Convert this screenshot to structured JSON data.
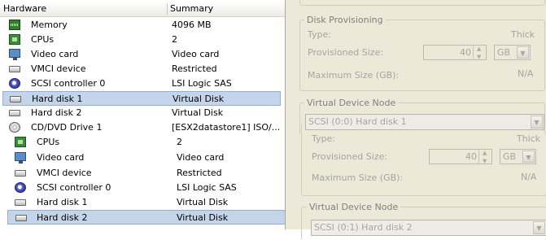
{
  "list_header": {
    "col_hardware": "Hardware",
    "col_summary": "Summary"
  },
  "top_list": [
    {
      "icon": "memory-icon",
      "name": "Memory",
      "summary": "4096 MB"
    },
    {
      "icon": "cpu-icon",
      "name": "CPUs",
      "summary": "2"
    },
    {
      "icon": "video-card-icon",
      "name": "Video card",
      "summary": "Video card"
    },
    {
      "icon": "vmci-device-icon",
      "name": "VMCI device",
      "summary": "Restricted"
    },
    {
      "icon": "scsi-controller-icon",
      "name": "SCSI controller 0",
      "summary": "LSI Logic SAS"
    },
    {
      "icon": "hard-disk-icon",
      "name": "Hard disk 1",
      "summary": "Virtual Disk",
      "selected": true
    },
    {
      "icon": "hard-disk-icon",
      "name": "Hard disk 2",
      "summary": "Virtual Disk"
    },
    {
      "icon": "cd-dvd-icon",
      "name": "CD/DVD Drive 1",
      "summary": "[ESX2datastore1] ISO/..."
    }
  ],
  "bottom_list": [
    {
      "icon": "cpu-icon",
      "name": "CPUs",
      "summary": "2"
    },
    {
      "icon": "video-card-icon",
      "name": "Video card",
      "summary": "Video card"
    },
    {
      "icon": "vmci-device-icon",
      "name": "VMCI device",
      "summary": "Restricted"
    },
    {
      "icon": "scsi-controller-icon",
      "name": "SCSI controller 0",
      "summary": "LSI Logic SAS"
    },
    {
      "icon": "hard-disk-icon",
      "name": "Hard disk 1",
      "summary": "Virtual Disk"
    },
    {
      "icon": "hard-disk-icon",
      "name": "Hard disk 2",
      "summary": "Virtual Disk",
      "selected": true
    }
  ],
  "top_panel": {
    "disk_provisioning": {
      "title": "Disk Provisioning",
      "type_label": "Type:",
      "type_value": "Thick",
      "provisioned_label": "Provisioned Size:",
      "provisioned_value": "40",
      "unit": "GB",
      "max_label": "Maximum Size (GB):",
      "max_value": "N/A"
    },
    "virtual_device_node": {
      "title": "Virtual Device Node",
      "selected": "SCSI (0:0) Hard disk 1"
    }
  },
  "bottom_panel": {
    "disk_provisioning": {
      "type_label": "Type:",
      "type_value": "Thick",
      "provisioned_label": "Provisioned Size:",
      "provisioned_value": "40",
      "unit": "GB",
      "max_label": "Maximum Size (GB):",
      "max_value": "N/A"
    },
    "virtual_device_node": {
      "title": "Virtual Device Node",
      "selected": "SCSI (0:1) Hard disk 2"
    }
  },
  "colors": {
    "selection": "#c4d4ea",
    "panel_bg": "#ece9d8",
    "disabled_text": "#a4a4a4"
  }
}
